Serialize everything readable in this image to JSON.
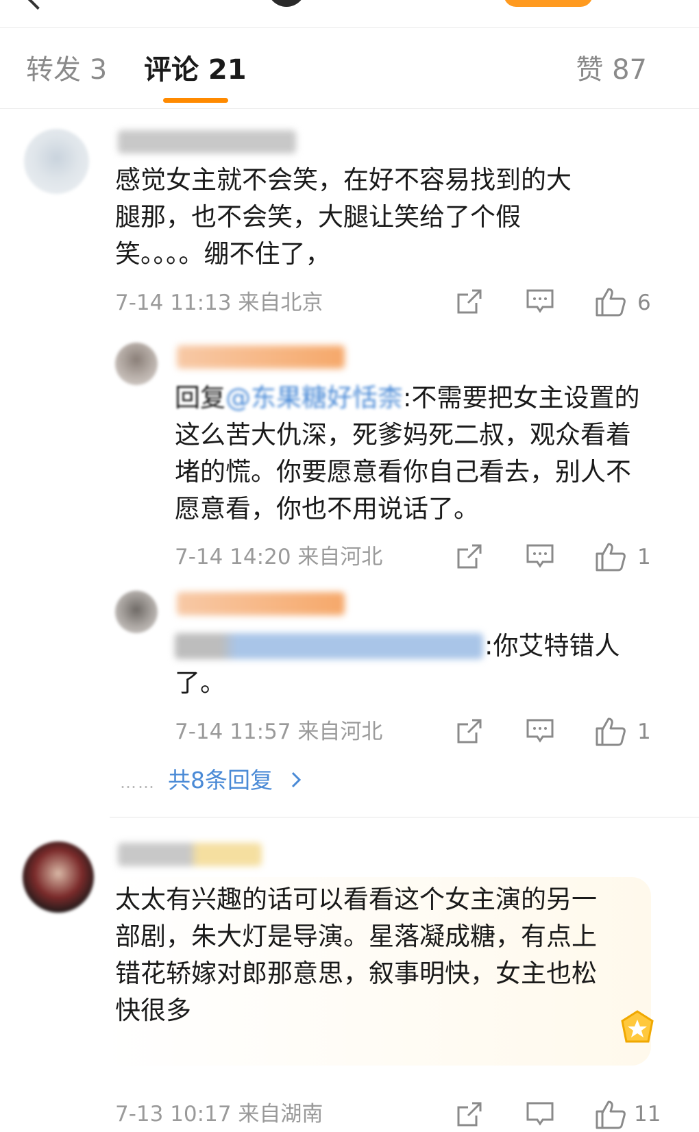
{
  "tabs": {
    "repost": "转发 3",
    "comments": "评论 21",
    "likes": "赞 87"
  },
  "comments": [
    {
      "text": "感觉女主就不会笑，在好不容易找到的大腿那，也不会笑，大腿让笑给了个假笑。。。。绷不住了，",
      "meta": "7-14 11:13 来自北京",
      "like_count": "6"
    },
    {
      "reply_prefix": "回复",
      "mention": "@东果糖好恬柰",
      "text": ":不需要把女主设置的这么苦大仇深，死爹妈死二叔，观众看着堵的慌。你要愿意看你自己看去，别人不愿意看，你也不用说话了。",
      "meta": "7-14 14:20 来自河北",
      "like_count": "1"
    },
    {
      "text": ":你艾特错人了。",
      "meta": "7-14 11:57 来自河北",
      "like_count": "1"
    },
    {
      "text": "太太有兴趣的话可以看看这个女主演的另一部剧，朱大灯是导演。星落凝成糖，有点上错花轿嫁对郎那意思，叙事明快，女主也松快很多",
      "meta": "7-13 10:17 来自湖南",
      "like_count": "11"
    }
  ],
  "more_replies": {
    "dots": "……",
    "label": "共8条回复"
  },
  "icons": [
    "back-arrow-icon",
    "share-icon",
    "comment-icon",
    "like-icon",
    "chevron-right-icon",
    "fan-badge-icon"
  ],
  "colors": {
    "accent": "#ff8a00",
    "link": "#4a8ad6",
    "meta": "#9a9a9a"
  }
}
